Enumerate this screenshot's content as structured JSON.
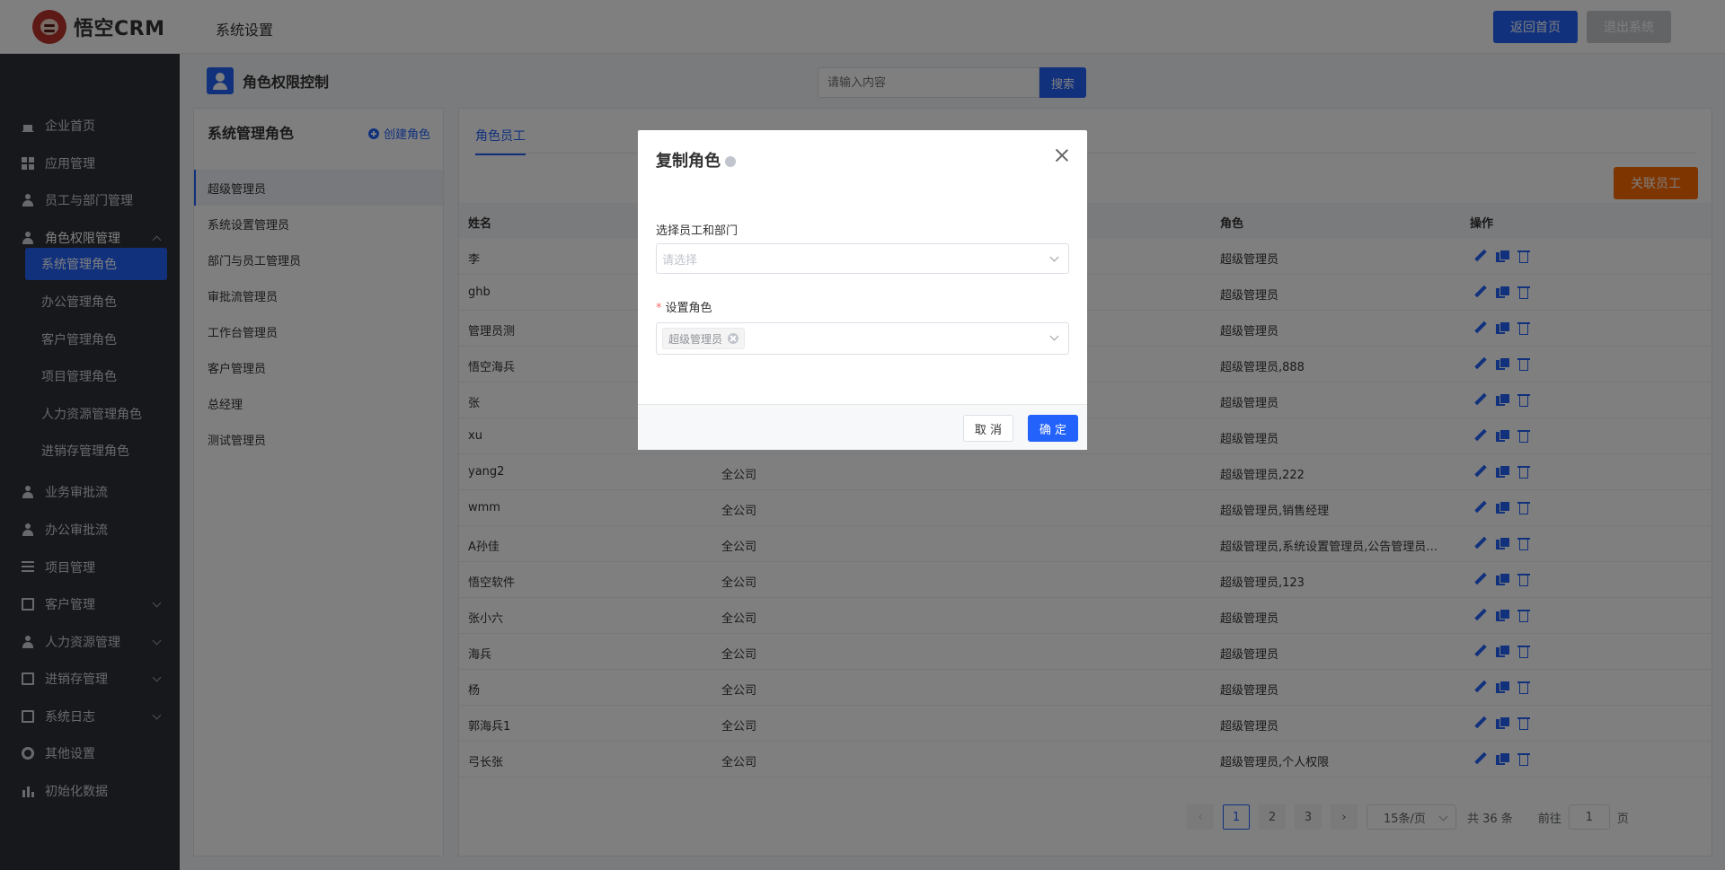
{
  "header": {
    "logo_text": "悟空CRM",
    "title": "系统设置",
    "home_button": "返回首页",
    "logout_button": "退出系统"
  },
  "sidebar": {
    "items": [
      {
        "label": "企业首页",
        "icon": "home-icon"
      },
      {
        "label": "应用管理",
        "icon": "grid-icon"
      },
      {
        "label": "员工与部门管理",
        "icon": "users-icon"
      },
      {
        "label": "角色权限管理",
        "icon": "user-icon"
      }
    ],
    "sub_items": [
      "系统管理角色",
      "办公管理角色",
      "客户管理角色",
      "项目管理角色",
      "人力资源管理角色",
      "进销存管理角色"
    ],
    "lower_items": [
      {
        "label": "业务审批流",
        "icon": "user-icon"
      },
      {
        "label": "办公审批流",
        "icon": "user-icon"
      },
      {
        "label": "项目管理",
        "icon": "list-icon"
      },
      {
        "label": "客户管理",
        "icon": "doc-icon"
      },
      {
        "label": "人力资源管理",
        "icon": "users-icon"
      },
      {
        "label": "进销存管理",
        "icon": "doc-icon"
      },
      {
        "label": "系统日志",
        "icon": "doc-icon"
      },
      {
        "label": "其他设置",
        "icon": "gear-icon"
      },
      {
        "label": "初始化数据",
        "icon": "bars-icon"
      }
    ]
  },
  "page": {
    "title": "角色权限控制",
    "search_placeholder": "请输入内容",
    "search_button": "搜索"
  },
  "roles_panel": {
    "title": "系统管理角色",
    "create_button": "创建角色",
    "roles": [
      "超级管理员",
      "系统设置管理员",
      "部门与员工管理员",
      "审批流管理员",
      "工作台管理员",
      "客户管理员",
      "总经理",
      "测试管理员"
    ]
  },
  "main": {
    "tab": "角色员工",
    "link_button": "关联员工",
    "columns": {
      "name": "姓名",
      "role": "角色",
      "ops": "操作"
    },
    "rows": [
      {
        "name": "李",
        "dept": "",
        "role": "超级管理员"
      },
      {
        "name": "ghb",
        "dept": "",
        "role": "超级管理员"
      },
      {
        "name": "管理员测",
        "dept": "",
        "role": "超级管理员"
      },
      {
        "name": "悟空海兵",
        "dept": "",
        "role": "超级管理员,888"
      },
      {
        "name": "张",
        "dept": "",
        "role": "超级管理员"
      },
      {
        "name": "xu",
        "dept": "",
        "role": "超级管理员"
      },
      {
        "name": "yang2",
        "dept": "全公司",
        "role": "超级管理员,222"
      },
      {
        "name": "wmm",
        "dept": "全公司",
        "role": "超级管理员,销售经理"
      },
      {
        "name": "A孙佳",
        "dept": "全公司",
        "role": "超级管理员,系统设置管理员,公告管理员,..."
      },
      {
        "name": "悟空软件",
        "dept": "全公司",
        "role": "超级管理员,123"
      },
      {
        "name": "张小六",
        "dept": "全公司",
        "role": "超级管理员"
      },
      {
        "name": "海兵",
        "dept": "全公司",
        "role": "超级管理员"
      },
      {
        "name": "杨",
        "dept": "全公司",
        "role": "超级管理员"
      },
      {
        "name": "郭海兵1",
        "dept": "全公司",
        "role": "超级管理员"
      },
      {
        "name": "弓长张",
        "dept": "全公司",
        "role": "超级管理员,个人权限"
      }
    ],
    "pagination": {
      "pages": [
        "1",
        "2",
        "3"
      ],
      "page_size": "15条/页",
      "total": "共 36 条",
      "goto_label": "前往",
      "goto_value": "1",
      "page_suffix": "页"
    }
  },
  "modal": {
    "title": "复制角色",
    "field1_label": "选择员工和部门",
    "field1_placeholder": "请选择",
    "field2_required": "*",
    "field2_label": "设置角色",
    "field2_tag": "超级管理员",
    "cancel": "取 消",
    "ok": "确 定"
  }
}
